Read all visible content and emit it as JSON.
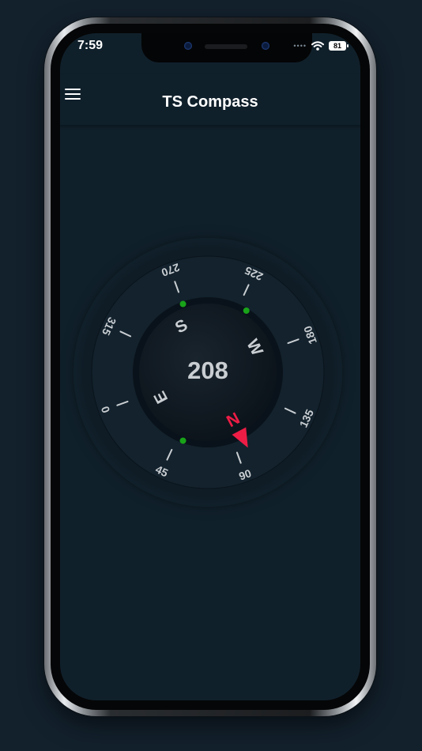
{
  "status_bar": {
    "time": "7:59",
    "battery": "81"
  },
  "header": {
    "title": "TS Compass"
  },
  "compass": {
    "heading": "208",
    "degree_labels": [
      "0",
      "45",
      "90",
      "135",
      "180",
      "225",
      "270",
      "315"
    ],
    "cardinals": [
      "N",
      "E",
      "S",
      "W"
    ],
    "colors": {
      "background": "#10202b",
      "dial_dark": "#0c161e",
      "text": "#c9ced2",
      "north": "#ee1d46",
      "marker": "#19a319"
    },
    "icons": [
      "menu-icon",
      "wifi-icon",
      "north-pointer-icon"
    ]
  }
}
